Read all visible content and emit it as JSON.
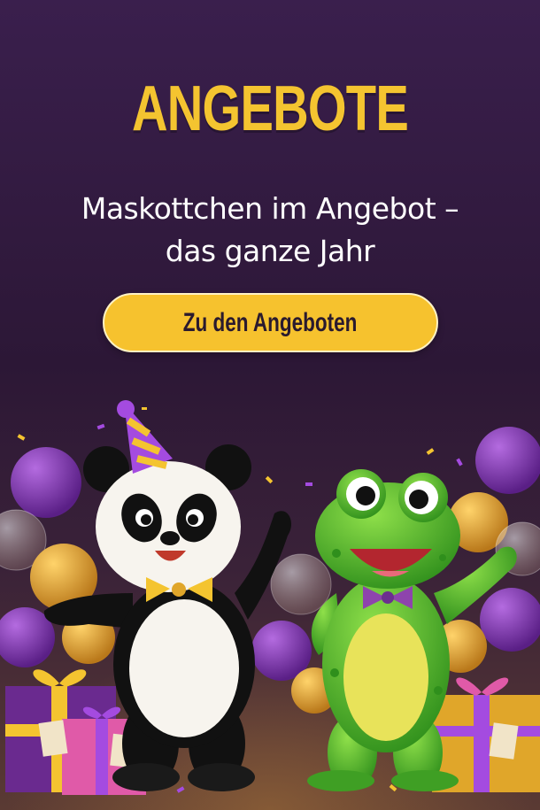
{
  "hero": {
    "title": "ANGEBOTE",
    "subtitle_line1": "Maskottchen im Angebot –",
    "subtitle_line2": "das ganze Jahr",
    "cta_label": "Zu den Angeboten"
  },
  "colors": {
    "accent": "#f4c430",
    "background": "#2c1736",
    "text": "#ffffff"
  },
  "illustration": {
    "characters": [
      "panda-mascot",
      "frog-mascot"
    ],
    "props": [
      "party-hat",
      "balloons",
      "gift-boxes",
      "confetti"
    ]
  }
}
